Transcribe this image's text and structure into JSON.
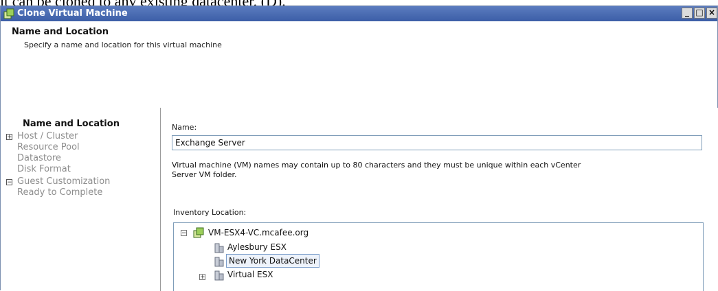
{
  "caption": "it can be cloned to any existing datacenter, (D).",
  "window": {
    "title": "Clone Virtual Machine",
    "buttons": {
      "minimize": "_",
      "maximize": "□",
      "close": "×"
    }
  },
  "header": {
    "title": "Name and Location",
    "subtitle": "Specify a name and location for this virtual machine"
  },
  "steps": [
    {
      "label": "Name and Location",
      "state": "current",
      "expander": ""
    },
    {
      "label": "Host / Cluster",
      "state": "pending",
      "expander": "+"
    },
    {
      "label": "Resource Pool",
      "state": "pending",
      "expander": ""
    },
    {
      "label": "Datastore",
      "state": "pending",
      "expander": ""
    },
    {
      "label": "Disk Format",
      "state": "pending",
      "expander": ""
    },
    {
      "label": "Guest Customization",
      "state": "pending",
      "expander": "−"
    },
    {
      "label": "Ready to Complete",
      "state": "pending",
      "expander": ""
    }
  ],
  "form": {
    "name_label": "Name:",
    "name_value": "Exchange Server",
    "note": "Virtual machine (VM) names may contain up to 80 characters and they must be unique within each vCenter Server VM folder.",
    "inventory_label": "Inventory Location:"
  },
  "inventory": {
    "root": {
      "label": "VM-ESX4-VC.mcafee.org",
      "expander": "−",
      "icon": "vcenter-icon"
    },
    "children": [
      {
        "label": "Aylesbury ESX",
        "icon": "datacenter-icon",
        "expander": "",
        "selected": false
      },
      {
        "label": "New York DataCenter",
        "icon": "datacenter-icon",
        "expander": "",
        "selected": true
      },
      {
        "label": "Virtual ESX",
        "icon": "datacenter-icon",
        "expander": "+",
        "selected": false
      }
    ]
  },
  "colors": {
    "titlebar": "#3c5ea7",
    "pending_step": "#8d8d8d",
    "input_border": "#7f9db9"
  }
}
